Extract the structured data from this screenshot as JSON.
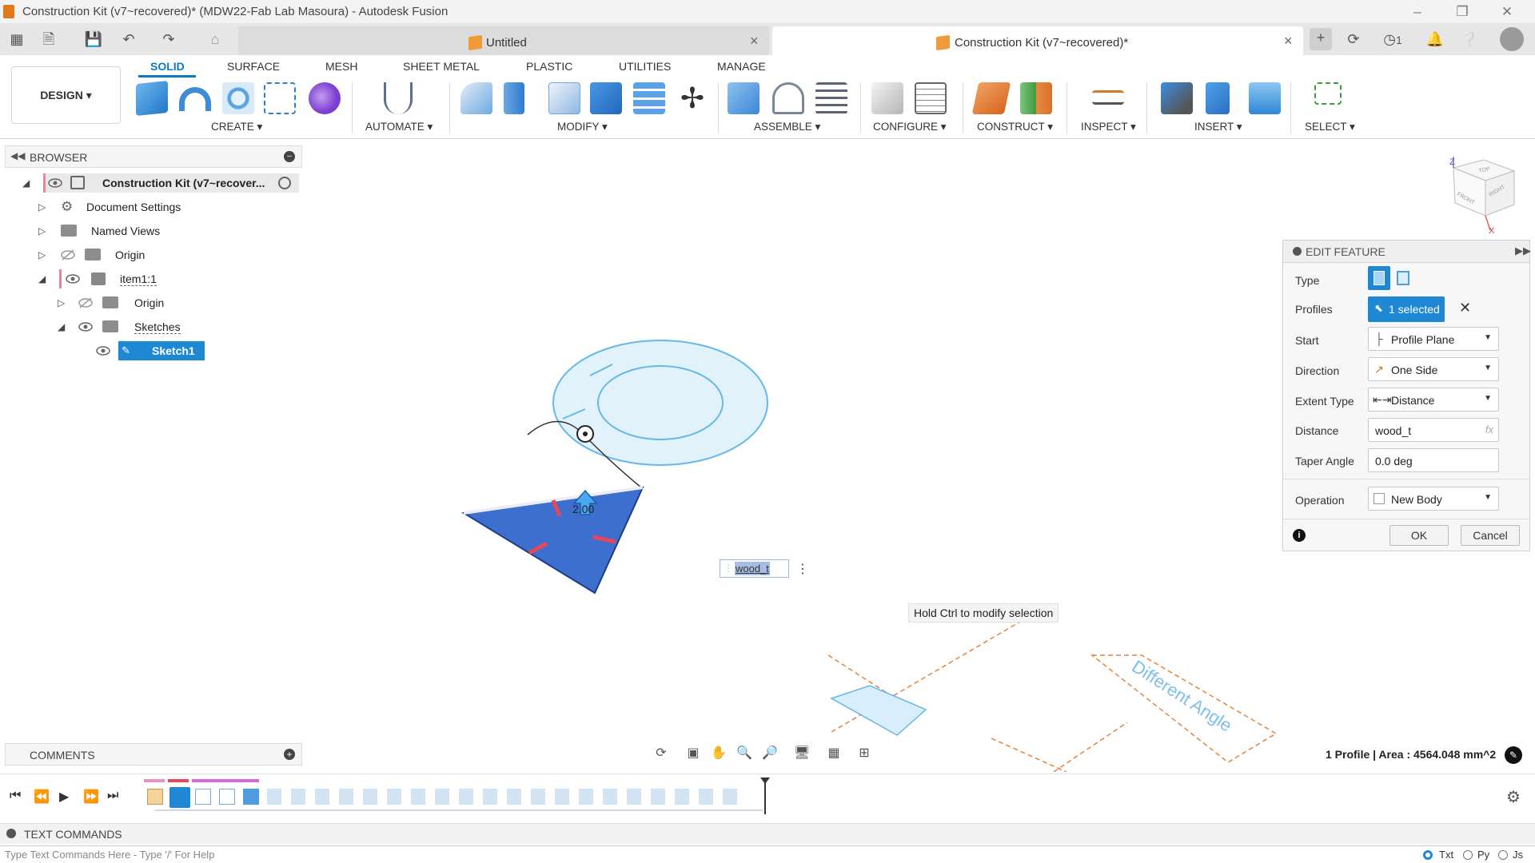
{
  "window": {
    "title": "Construction Kit (v7~recovered)* (MDW22-Fab Lab Masoura) - Autodesk Fusion"
  },
  "tabs": [
    {
      "label": "Untitled"
    },
    {
      "label": "Construction Kit (v7~recovered)*"
    }
  ],
  "tabbar_right": {
    "job_count": "1"
  },
  "ribbon": {
    "workspace": "DESIGN",
    "tabs": [
      "SOLID",
      "SURFACE",
      "MESH",
      "SHEET METAL",
      "PLASTIC",
      "UTILITIES",
      "MANAGE"
    ],
    "groups": [
      "CREATE",
      "AUTOMATE",
      "MODIFY",
      "ASSEMBLE",
      "CONFIGURE",
      "CONSTRUCT",
      "INSPECT",
      "INSERT",
      "SELECT"
    ]
  },
  "browser": {
    "header": "BROWSER",
    "root": "Construction Kit (v7~recover...",
    "items": [
      {
        "label": "Document Settings"
      },
      {
        "label": "Named Views"
      },
      {
        "label": "Origin"
      },
      {
        "label": "item1:1"
      },
      {
        "label": "Origin"
      },
      {
        "label": "Sketches"
      },
      {
        "label": "Sketch1"
      }
    ]
  },
  "edit_feature": {
    "title": "EDIT FEATURE",
    "rows": {
      "type": "Type",
      "profiles": "Profiles",
      "profiles_value": "1 selected",
      "start": "Start",
      "start_value": "Profile Plane",
      "direction": "Direction",
      "direction_value": "One Side",
      "extent_type": "Extent Type",
      "extent_value": "Distance",
      "distance": "Distance",
      "distance_value": "wood_t",
      "distance_fx": "fx",
      "taper": "Taper Angle",
      "taper_value": "0.0 deg",
      "operation": "Operation",
      "operation_value": "New Body"
    },
    "ok": "OK",
    "cancel": "Cancel"
  },
  "canvas": {
    "dimension_input": "wood_t",
    "dimension_value": "2.00",
    "tooltip": "Hold Ctrl to modify selection",
    "sketch_text": "Different Angle",
    "status": "1 Profile | Area : 4564.048 mm^2",
    "viewcube": {
      "front": "FRONT",
      "right": "RIGHT",
      "top": "TOP",
      "axis_z": "Z",
      "axis_x": "X"
    }
  },
  "comments": {
    "header": "COMMENTS"
  },
  "text_commands": {
    "header": "TEXT COMMANDS",
    "placeholder": "Type Text Commands Here - Type '/' For Help",
    "modes": [
      "Txt",
      "Py",
      "Js"
    ]
  },
  "colors": {
    "accent": "#0a7ac6",
    "selection_blue": "#1e88d4",
    "profile_fill": "#3d6fcf",
    "sketch_light": "#66b8e8",
    "construction_orange": "#e8833a"
  }
}
